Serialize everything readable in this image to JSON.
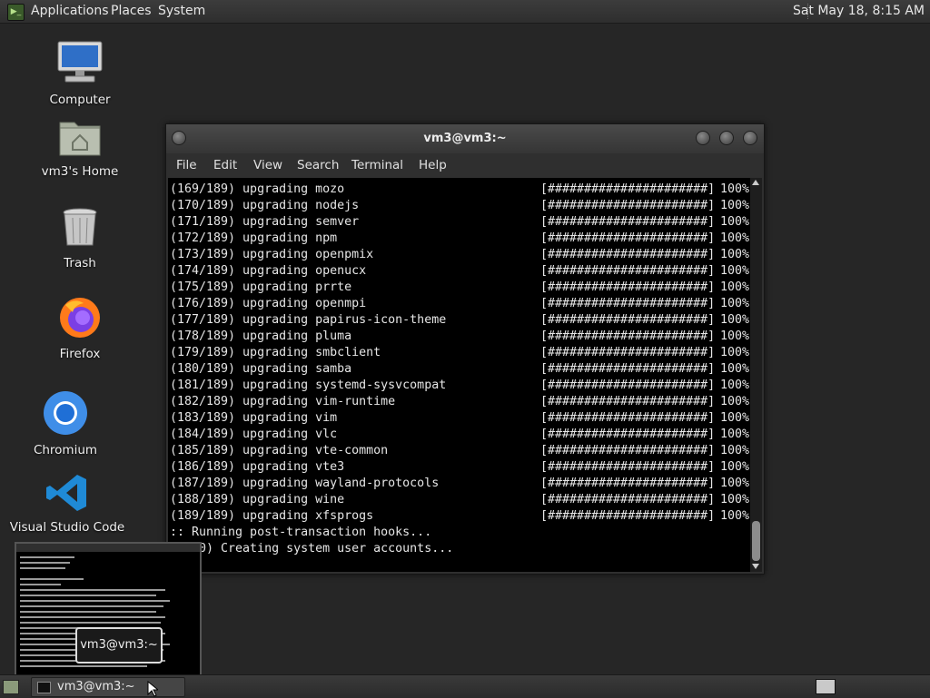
{
  "top_panel": {
    "menu": [
      "Applications",
      "Places",
      "System"
    ],
    "clock": "Sat May 18,  8:15 AM"
  },
  "desktop_icons": [
    {
      "label": "Computer",
      "icon": "computer-icon"
    },
    {
      "label": "vm3's Home",
      "icon": "home-folder-icon"
    },
    {
      "label": "Trash",
      "icon": "trash-icon"
    },
    {
      "label": "Firefox",
      "icon": "firefox-icon"
    },
    {
      "label": "Chromium",
      "icon": "chromium-icon"
    },
    {
      "label": "Visual Studio Code",
      "icon": "vscode-icon"
    }
  ],
  "terminal": {
    "title": "vm3@vm3:~",
    "menu": [
      "File",
      "Edit",
      "View",
      "Search",
      "Terminal",
      "Help"
    ],
    "progress_bar": "[######################]",
    "lines": [
      {
        "text": "(169/189) upgrading mozo",
        "pct": "100%"
      },
      {
        "text": "(170/189) upgrading nodejs",
        "pct": "100%"
      },
      {
        "text": "(171/189) upgrading semver",
        "pct": "100%"
      },
      {
        "text": "(172/189) upgrading npm",
        "pct": "100%"
      },
      {
        "text": "(173/189) upgrading openpmix",
        "pct": "100%"
      },
      {
        "text": "(174/189) upgrading openucx",
        "pct": "100%"
      },
      {
        "text": "(175/189) upgrading prrte",
        "pct": "100%"
      },
      {
        "text": "(176/189) upgrading openmpi",
        "pct": "100%"
      },
      {
        "text": "(177/189) upgrading papirus-icon-theme",
        "pct": "100%"
      },
      {
        "text": "(178/189) upgrading pluma",
        "pct": "100%"
      },
      {
        "text": "(179/189) upgrading smbclient",
        "pct": "100%"
      },
      {
        "text": "(180/189) upgrading samba",
        "pct": "100%"
      },
      {
        "text": "(181/189) upgrading systemd-sysvcompat",
        "pct": "100%"
      },
      {
        "text": "(182/189) upgrading vim-runtime",
        "pct": "100%"
      },
      {
        "text": "(183/189) upgrading vim",
        "pct": "100%"
      },
      {
        "text": "(184/189) upgrading vlc",
        "pct": "100%"
      },
      {
        "text": "(185/189) upgrading vte-common",
        "pct": "100%"
      },
      {
        "text": "(186/189) upgrading vte3",
        "pct": "100%"
      },
      {
        "text": "(187/189) upgrading wayland-protocols",
        "pct": "100%"
      },
      {
        "text": "(188/189) upgrading wine",
        "pct": "100%"
      },
      {
        "text": "(189/189) upgrading xfsprogs",
        "pct": "100%"
      }
    ],
    "tail": [
      ":: Running post-transaction hooks...",
      "(  30) Creating system user accounts..."
    ]
  },
  "preview": {
    "label": "vm3@vm3:~"
  },
  "taskbar": {
    "window_label": "vm3@vm3:~"
  },
  "colors": {
    "desktop_bg": "#262626",
    "terminal_bg": "#000000",
    "panel_bg": "#333333"
  }
}
